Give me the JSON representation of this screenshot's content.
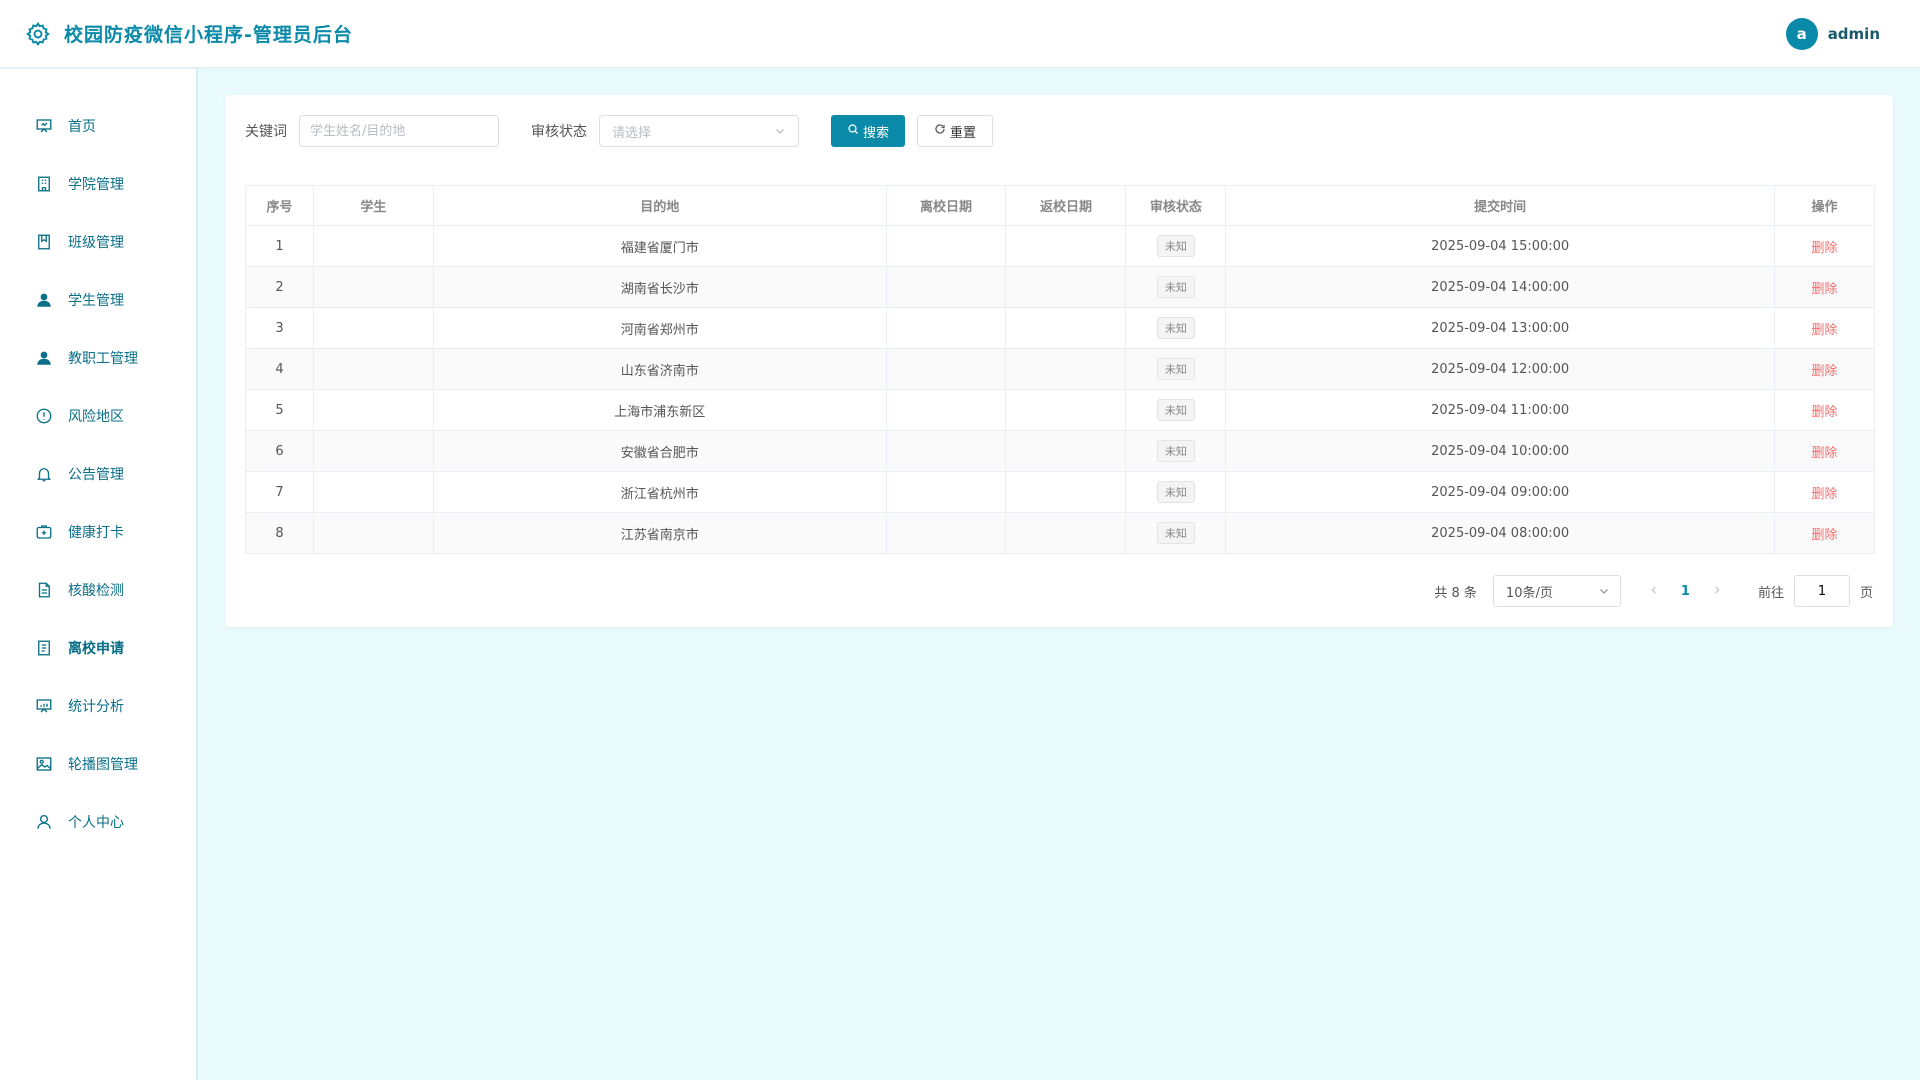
{
  "header": {
    "title": "校园防疫微信小程序-管理员后台",
    "avatar_letter": "a",
    "username": "admin",
    "accent": "#0a8aa8"
  },
  "sidebar": {
    "items": [
      {
        "label": "首页",
        "icon": "presentation-icon"
      },
      {
        "label": "学院管理",
        "icon": "building-icon"
      },
      {
        "label": "班级管理",
        "icon": "bookmark-icon"
      },
      {
        "label": "学生管理",
        "icon": "user-filled-icon"
      },
      {
        "label": "教职工管理",
        "icon": "user-filled-icon"
      },
      {
        "label": "风险地区",
        "icon": "warning-circle-icon"
      },
      {
        "label": "公告管理",
        "icon": "bell-icon"
      },
      {
        "label": "健康打卡",
        "icon": "first-aid-icon"
      },
      {
        "label": "核酸检测",
        "icon": "document-icon"
      },
      {
        "label": "离校申请",
        "icon": "checklist-icon",
        "active": true
      },
      {
        "label": "统计分析",
        "icon": "chart-board-icon"
      },
      {
        "label": "轮播图管理",
        "icon": "image-icon"
      },
      {
        "label": "个人中心",
        "icon": "user-outline-icon"
      }
    ]
  },
  "filters": {
    "keyword_label": "关键词",
    "keyword_placeholder": "学生姓名/目的地",
    "status_label": "审核状态",
    "status_placeholder": "请选择",
    "search_label": "搜索",
    "reset_label": "重置"
  },
  "table": {
    "columns": [
      "序号",
      "学生",
      "目的地",
      "离校日期",
      "返校日期",
      "审核状态",
      "提交时间",
      "操作"
    ],
    "rows": [
      {
        "no": "1",
        "student": "",
        "dest": "福建省厦门市",
        "leave": "",
        "back": "",
        "status": "未知",
        "time": "2025-09-04 15:00:00",
        "action": "删除"
      },
      {
        "no": "2",
        "student": "",
        "dest": "湖南省长沙市",
        "leave": "",
        "back": "",
        "status": "未知",
        "time": "2025-09-04 14:00:00",
        "action": "删除"
      },
      {
        "no": "3",
        "student": "",
        "dest": "河南省郑州市",
        "leave": "",
        "back": "",
        "status": "未知",
        "time": "2025-09-04 13:00:00",
        "action": "删除"
      },
      {
        "no": "4",
        "student": "",
        "dest": "山东省济南市",
        "leave": "",
        "back": "",
        "status": "未知",
        "time": "2025-09-04 12:00:00",
        "action": "删除"
      },
      {
        "no": "5",
        "student": "",
        "dest": "上海市浦东新区",
        "leave": "",
        "back": "",
        "status": "未知",
        "time": "2025-09-04 11:00:00",
        "action": "删除"
      },
      {
        "no": "6",
        "student": "",
        "dest": "安徽省合肥市",
        "leave": "",
        "back": "",
        "status": "未知",
        "time": "2025-09-04 10:00:00",
        "action": "删除"
      },
      {
        "no": "7",
        "student": "",
        "dest": "浙江省杭州市",
        "leave": "",
        "back": "",
        "status": "未知",
        "time": "2025-09-04 09:00:00",
        "action": "删除"
      },
      {
        "no": "8",
        "student": "",
        "dest": "江苏省南京市",
        "leave": "",
        "back": "",
        "status": "未知",
        "time": "2025-09-04 08:00:00",
        "action": "删除"
      }
    ]
  },
  "pagination": {
    "total_text": "共 8 条",
    "page_size": "10条/页",
    "current_page": "1",
    "goto_label": "前往",
    "goto_value": "1",
    "page_suffix": "页"
  }
}
